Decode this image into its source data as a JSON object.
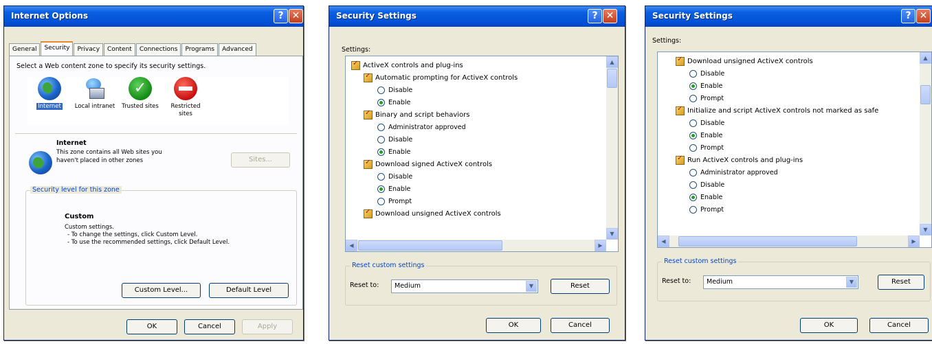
{
  "internet_options": {
    "title": "Internet Options",
    "help": "?",
    "close": "✕",
    "tabs": [
      "General",
      "Security",
      "Privacy",
      "Content",
      "Connections",
      "Programs",
      "Advanced"
    ],
    "instruction": "Select a Web content zone to specify its security settings.",
    "zones": [
      {
        "label": "Internet",
        "icon": "globe-icon"
      },
      {
        "label": "Local intranet",
        "icon": "intranet-icon"
      },
      {
        "label": "Trusted sites",
        "icon": "check-icon"
      },
      {
        "label": "Restricted sites",
        "icon": "restricted-icon"
      }
    ],
    "zone_name": "Internet",
    "zone_desc_1": "This zone contains all Web sites you",
    "zone_desc_2": "haven't placed in other zones",
    "sites_button": "Sites...",
    "security_level_label": "Security level for this zone",
    "level_name": "Custom",
    "level_line_1": "Custom settings.",
    "level_line_2": "- To change the settings, click Custom Level.",
    "level_line_3": "- To use the recommended settings, click Default Level.",
    "custom_level_button": "Custom Level...",
    "default_level_button": "Default Level",
    "ok": "OK",
    "cancel": "Cancel",
    "apply": "Apply"
  },
  "security_settings_1": {
    "title": "Security Settings",
    "settings_label": "Settings:",
    "rows": [
      {
        "type": "header",
        "text": "ActiveX controls and plug-ins"
      },
      {
        "type": "sub",
        "text": "Automatic prompting for ActiveX controls"
      },
      {
        "type": "radio",
        "text": "Disable",
        "checked": false
      },
      {
        "type": "radio",
        "text": "Enable",
        "checked": true
      },
      {
        "type": "sub",
        "text": "Binary and script behaviors"
      },
      {
        "type": "radio",
        "text": "Administrator approved",
        "checked": false
      },
      {
        "type": "radio",
        "text": "Disable",
        "checked": false
      },
      {
        "type": "radio",
        "text": "Enable",
        "checked": true
      },
      {
        "type": "sub",
        "text": "Download signed ActiveX controls"
      },
      {
        "type": "radio",
        "text": "Disable",
        "checked": false
      },
      {
        "type": "radio",
        "text": "Enable",
        "checked": true
      },
      {
        "type": "radio",
        "text": "Prompt",
        "checked": false
      },
      {
        "type": "sub",
        "text": "Download unsigned ActiveX controls"
      }
    ],
    "reset_group_label": "Reset custom settings",
    "reset_to_label": "Reset to:",
    "reset_to_value": "Medium",
    "reset_button": "Reset",
    "ok": "OK",
    "cancel": "Cancel"
  },
  "security_settings_2": {
    "title": "Security Settings",
    "settings_label": "Settings:",
    "rows": [
      {
        "type": "sub",
        "text": "Download unsigned ActiveX controls"
      },
      {
        "type": "radio",
        "text": "Disable",
        "checked": false
      },
      {
        "type": "radio",
        "text": "Enable",
        "checked": true
      },
      {
        "type": "radio",
        "text": "Prompt",
        "checked": false
      },
      {
        "type": "sub",
        "text": "Initialize and script ActiveX controls not marked as safe"
      },
      {
        "type": "radio",
        "text": "Disable",
        "checked": false
      },
      {
        "type": "radio",
        "text": "Enable",
        "checked": true
      },
      {
        "type": "radio",
        "text": "Prompt",
        "checked": false
      },
      {
        "type": "sub",
        "text": "Run ActiveX controls and plug-ins"
      },
      {
        "type": "radio",
        "text": "Administrator approved",
        "checked": false
      },
      {
        "type": "radio",
        "text": "Disable",
        "checked": false
      },
      {
        "type": "radio",
        "text": "Enable",
        "checked": true
      },
      {
        "type": "radio",
        "text": "Prompt",
        "checked": false
      }
    ],
    "reset_group_label": "Reset custom settings",
    "reset_to_label": "Reset to:",
    "reset_to_value": "Medium",
    "reset_button": "Reset",
    "ok": "OK",
    "cancel": "Cancel"
  }
}
